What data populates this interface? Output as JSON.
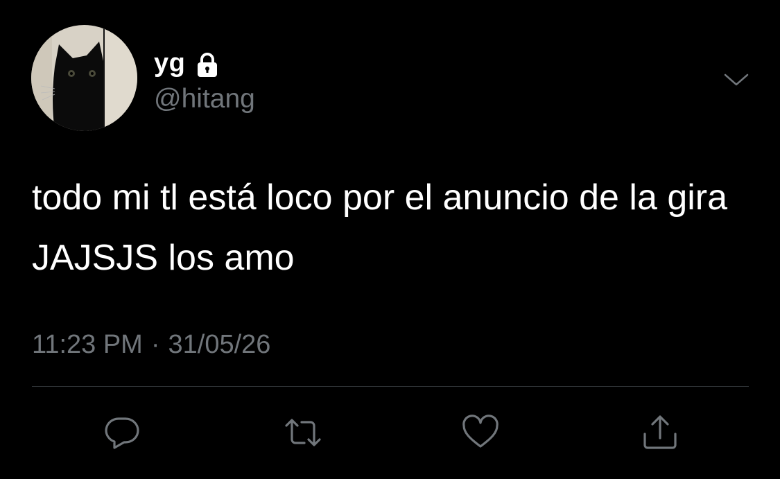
{
  "author": {
    "display_name": "yg",
    "handle": "@hitang",
    "protected_icon": "lock-icon",
    "avatar_icon": "black-cat-avatar"
  },
  "tweet": {
    "text": "todo mi tl está loco por el anuncio de la gira JAJSJS los amo",
    "time": "11:23 PM",
    "separator": "·",
    "date": "31/05/26"
  },
  "menu": {
    "icon": "chevron-down-icon"
  },
  "actions": [
    {
      "name": "reply",
      "icon": "reply-icon"
    },
    {
      "name": "retweet",
      "icon": "retweet-icon"
    },
    {
      "name": "like",
      "icon": "heart-icon"
    },
    {
      "name": "share",
      "icon": "share-icon"
    }
  ],
  "colors": {
    "background": "#000000",
    "primary_text": "#ffffff",
    "secondary_text": "#71767b",
    "divider": "#2f3336"
  }
}
